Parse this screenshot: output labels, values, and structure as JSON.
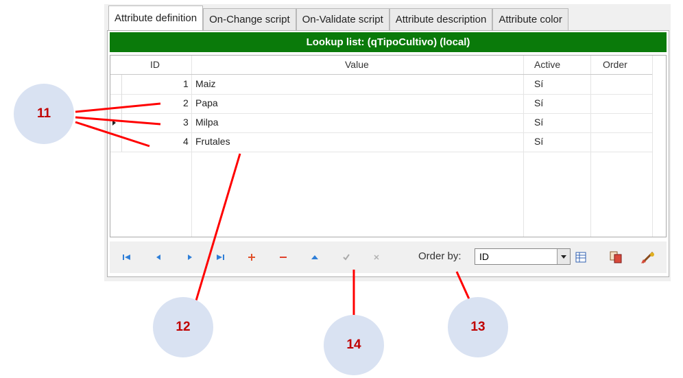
{
  "tabs": [
    "Attribute definition",
    "On-Change script",
    "On-Validate script",
    "Attribute description",
    "Attribute color"
  ],
  "title": "Lookup list: (qTipoCultivo) (local)",
  "columns": {
    "id": "ID",
    "value": "Value",
    "active": "Active",
    "order": "Order"
  },
  "rows": [
    {
      "id": "1",
      "value": "Maiz",
      "active": "Sí",
      "order": ""
    },
    {
      "id": "2",
      "value": "Papa",
      "active": "Sí",
      "order": ""
    },
    {
      "id": "3",
      "value": "Milpa",
      "active": "Sí",
      "order": ""
    },
    {
      "id": "4",
      "value": "Frutales",
      "active": "Sí",
      "order": ""
    }
  ],
  "selected_row": 3,
  "order_by": {
    "label": "Order by:",
    "value": "ID"
  },
  "nav_icons": [
    "first-record-icon",
    "prior-record-icon",
    "next-record-icon",
    "last-record-icon",
    "insert-icon",
    "delete-icon",
    "edit-icon",
    "post-icon",
    "cancel-icon"
  ],
  "callouts": [
    "11",
    "12",
    "13",
    "14"
  ],
  "colors": {
    "title_green": "#0a7a0a",
    "callout_fill": "#d9e2f2",
    "callout_text": "#c00000",
    "annotation_line": "#ff0000"
  }
}
